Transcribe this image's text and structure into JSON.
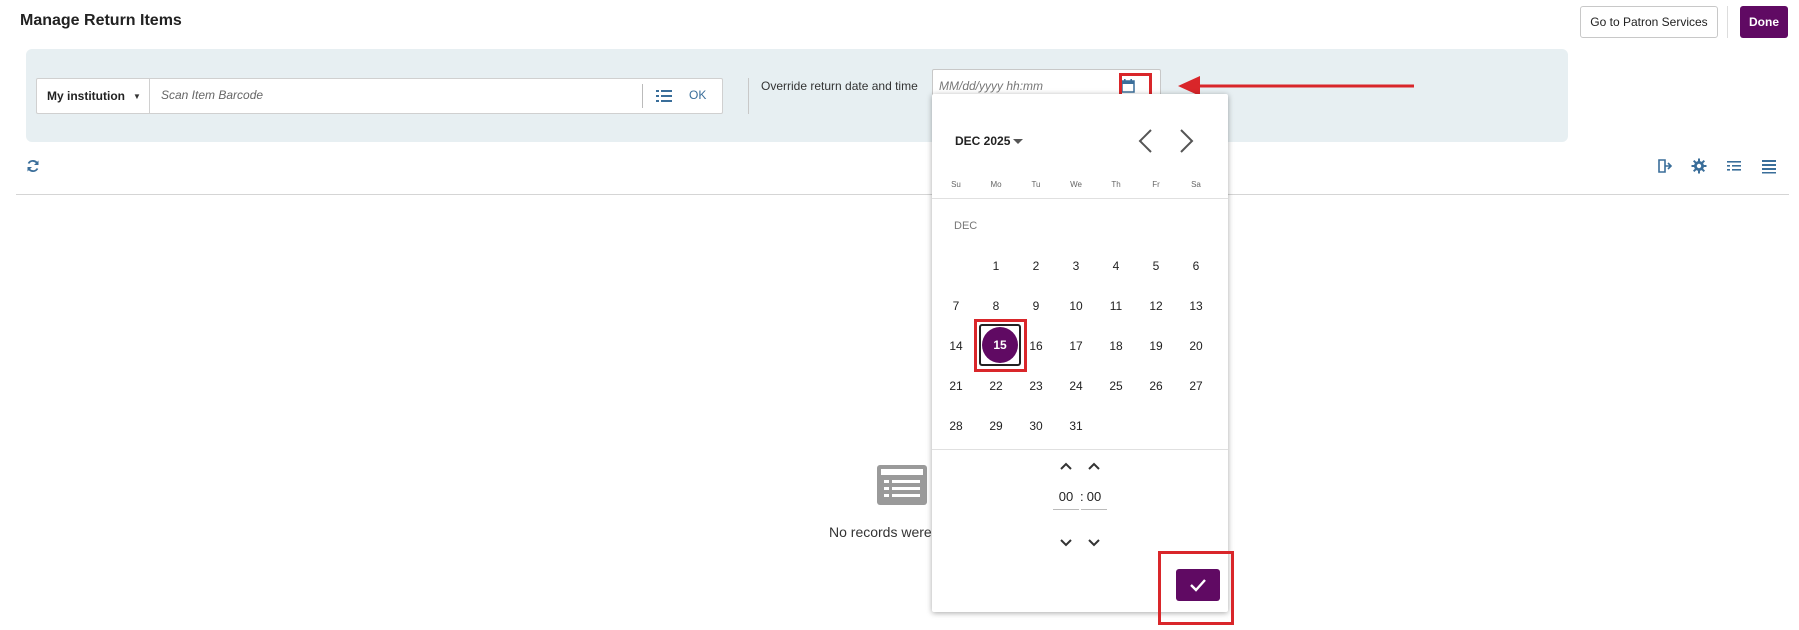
{
  "header": {
    "title": "Manage Return Items",
    "patron_services_label": "Go to Patron Services",
    "done_label": "Done"
  },
  "scan": {
    "institution": "My institution",
    "barcode_placeholder": "Scan Item Barcode",
    "ok_label": "OK"
  },
  "override": {
    "label": "Override return date and time",
    "date_placeholder": "MM/dd/yyyy hh:mm"
  },
  "calendar": {
    "month_year": "DEC 2025",
    "month_short": "DEC",
    "weekdays": [
      "Su",
      "Mo",
      "Tu",
      "We",
      "Th",
      "Fr",
      "Sa"
    ],
    "days": [
      "1",
      "2",
      "3",
      "4",
      "5",
      "6",
      "7",
      "8",
      "9",
      "10",
      "11",
      "12",
      "13",
      "14",
      "15",
      "16",
      "17",
      "18",
      "19",
      "20",
      "21",
      "22",
      "23",
      "24",
      "25",
      "26",
      "27",
      "28",
      "29",
      "30",
      "31"
    ],
    "selected_day": "15",
    "hour": "00",
    "minute": "00"
  },
  "empty_state": {
    "message": "No records were"
  },
  "colors": {
    "brand": "#600a63",
    "panel_bg": "#e7eff2",
    "link_blue": "#3a6e9a",
    "highlight_red": "#d9262a"
  },
  "icons": [
    "calendar-icon",
    "list-icon",
    "refresh-icon",
    "export-icon",
    "gear-icon",
    "filter-list-icon",
    "view-list-icon",
    "records-icon",
    "check-icon",
    "chevron-up-icon",
    "chevron-down-icon",
    "chevron-left-icon",
    "chevron-right-icon"
  ]
}
